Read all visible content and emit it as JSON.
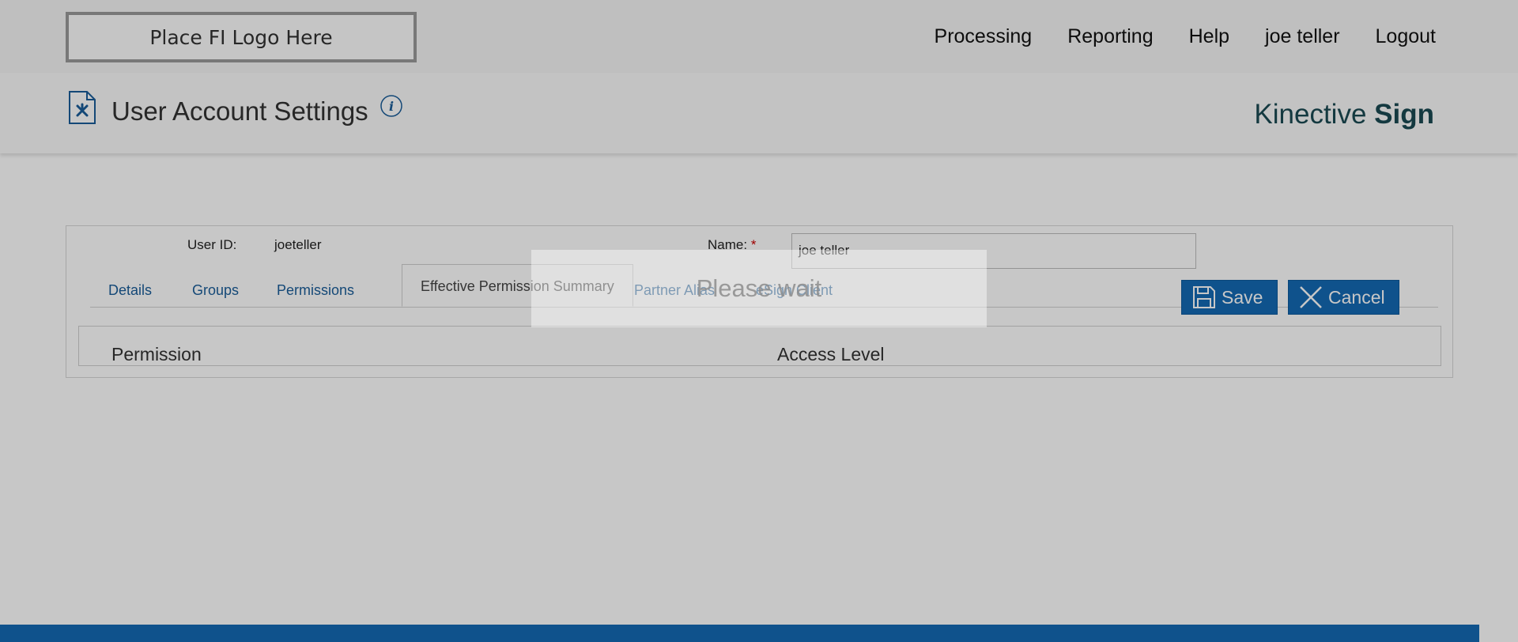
{
  "header": {
    "logo_text": "Place FI Logo Here",
    "nav": [
      "Processing",
      "Reporting",
      "Help",
      "joe teller",
      "Logout"
    ]
  },
  "titlebar": {
    "title": "User Account Settings",
    "info_icon": "info-icon",
    "doc_icon": "settings-document-icon",
    "brand_regular": "Kinective",
    "brand_bold": "Sign"
  },
  "form": {
    "user_id_label": "User ID:",
    "user_id_value": "joeteller",
    "name_label": "Name:",
    "required_marker": "*",
    "name_value": "joe teller"
  },
  "tabs": [
    {
      "label": "Details",
      "active": false
    },
    {
      "label": "Groups",
      "active": false
    },
    {
      "label": "Permissions",
      "active": false
    },
    {
      "label": "Effective Permission Summary",
      "active": true
    },
    {
      "label": "Partner Alias",
      "active": false
    },
    {
      "label": "eSign Client",
      "active": false
    }
  ],
  "buttons": {
    "save_label": "Save",
    "save_icon": "floppy-disk-icon",
    "cancel_label": "Cancel",
    "cancel_icon": "close-icon"
  },
  "table": {
    "columns": [
      "Permission",
      "Access Level"
    ]
  },
  "overlay": {
    "message": "Please wait"
  },
  "colors": {
    "accent": "#1469b4",
    "link": "#1a5d99",
    "brand": "#1a4a52",
    "required": "#cc0000"
  }
}
